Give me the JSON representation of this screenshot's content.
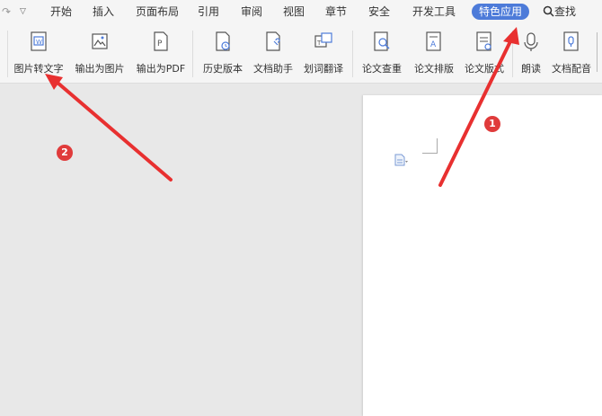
{
  "menu": {
    "items": [
      "开始",
      "插入",
      "页面布局",
      "引用",
      "审阅",
      "视图",
      "章节",
      "安全",
      "开发工具"
    ],
    "active": "特色应用",
    "search": "查找"
  },
  "ribbon": {
    "group1": [
      "图片转文字",
      "输出为图片",
      "输出为PDF"
    ],
    "group2": [
      "历史版本",
      "文档助手",
      "划词翻译"
    ],
    "group3": [
      "论文查重",
      "论文排版",
      "论文版式"
    ],
    "group4": [
      "朗读",
      "文档配音"
    ]
  },
  "annotations": {
    "badge1": "1",
    "badge2": "2"
  },
  "colors": {
    "accent": "#4d7bd9",
    "arrow": "#e83030"
  }
}
